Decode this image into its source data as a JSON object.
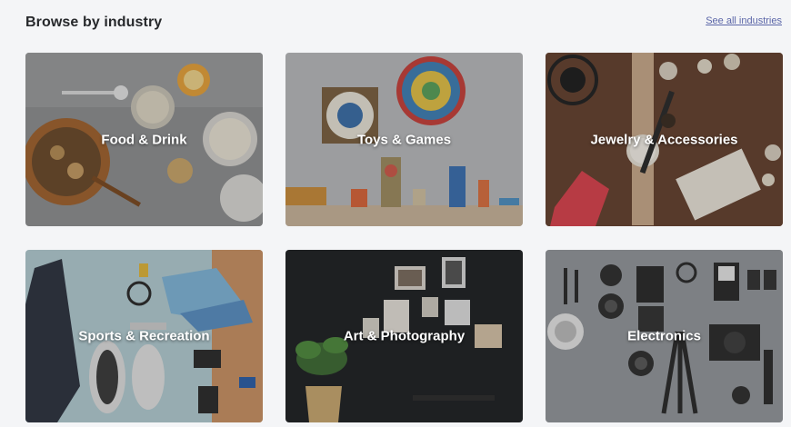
{
  "section": {
    "title": "Browse by industry",
    "see_all_label": "See all industries"
  },
  "industries": [
    {
      "label": "Food & Drink"
    },
    {
      "label": "Toys & Games"
    },
    {
      "label": "Jewelry & Accessories"
    },
    {
      "label": "Sports & Recreation"
    },
    {
      "label": "Art & Photography"
    },
    {
      "label": "Electronics"
    }
  ]
}
